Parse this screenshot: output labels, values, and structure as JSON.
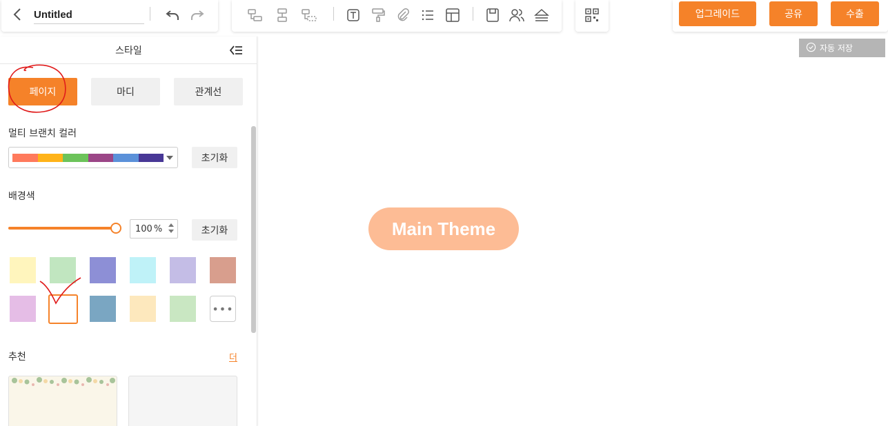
{
  "header": {
    "title_value": "Untitled"
  },
  "toolbar_right": {
    "upgrade_label": "업그레이드",
    "share_label": "공유",
    "export_label": "수출"
  },
  "autosave": {
    "label": "자동 저장"
  },
  "panel": {
    "title": "스타일",
    "tabs": [
      {
        "label": "페이지",
        "active": true
      },
      {
        "label": "마디",
        "active": false
      },
      {
        "label": "관계선",
        "active": false
      }
    ],
    "multi_branch": {
      "label": "멀티 브랜치 컬러",
      "colors": [
        "#ff7a5c",
        "#ffb319",
        "#6cc35a",
        "#9b4687",
        "#5b91d9",
        "#483896"
      ],
      "reset_label": "초기화"
    },
    "background": {
      "label": "배경색",
      "opacity_value": "100",
      "opacity_unit": "%",
      "reset_label": "초기화",
      "swatches": [
        "#fff5bd",
        "#c1e6c0",
        "#8d8fd6",
        "#bff2f8",
        "#c4bde6",
        "#d89e8d",
        "#e5bde6",
        "#ffffff",
        "#7aa6c2",
        "#fde8bd",
        "#c9e7c2"
      ],
      "selected_index": 7,
      "more_label": "•••"
    },
    "recommend": {
      "label": "추천",
      "more_label": "더"
    }
  },
  "canvas": {
    "main_topic": "Main Theme",
    "node_color": "#fdbc95"
  },
  "colors": {
    "accent": "#f58229"
  }
}
